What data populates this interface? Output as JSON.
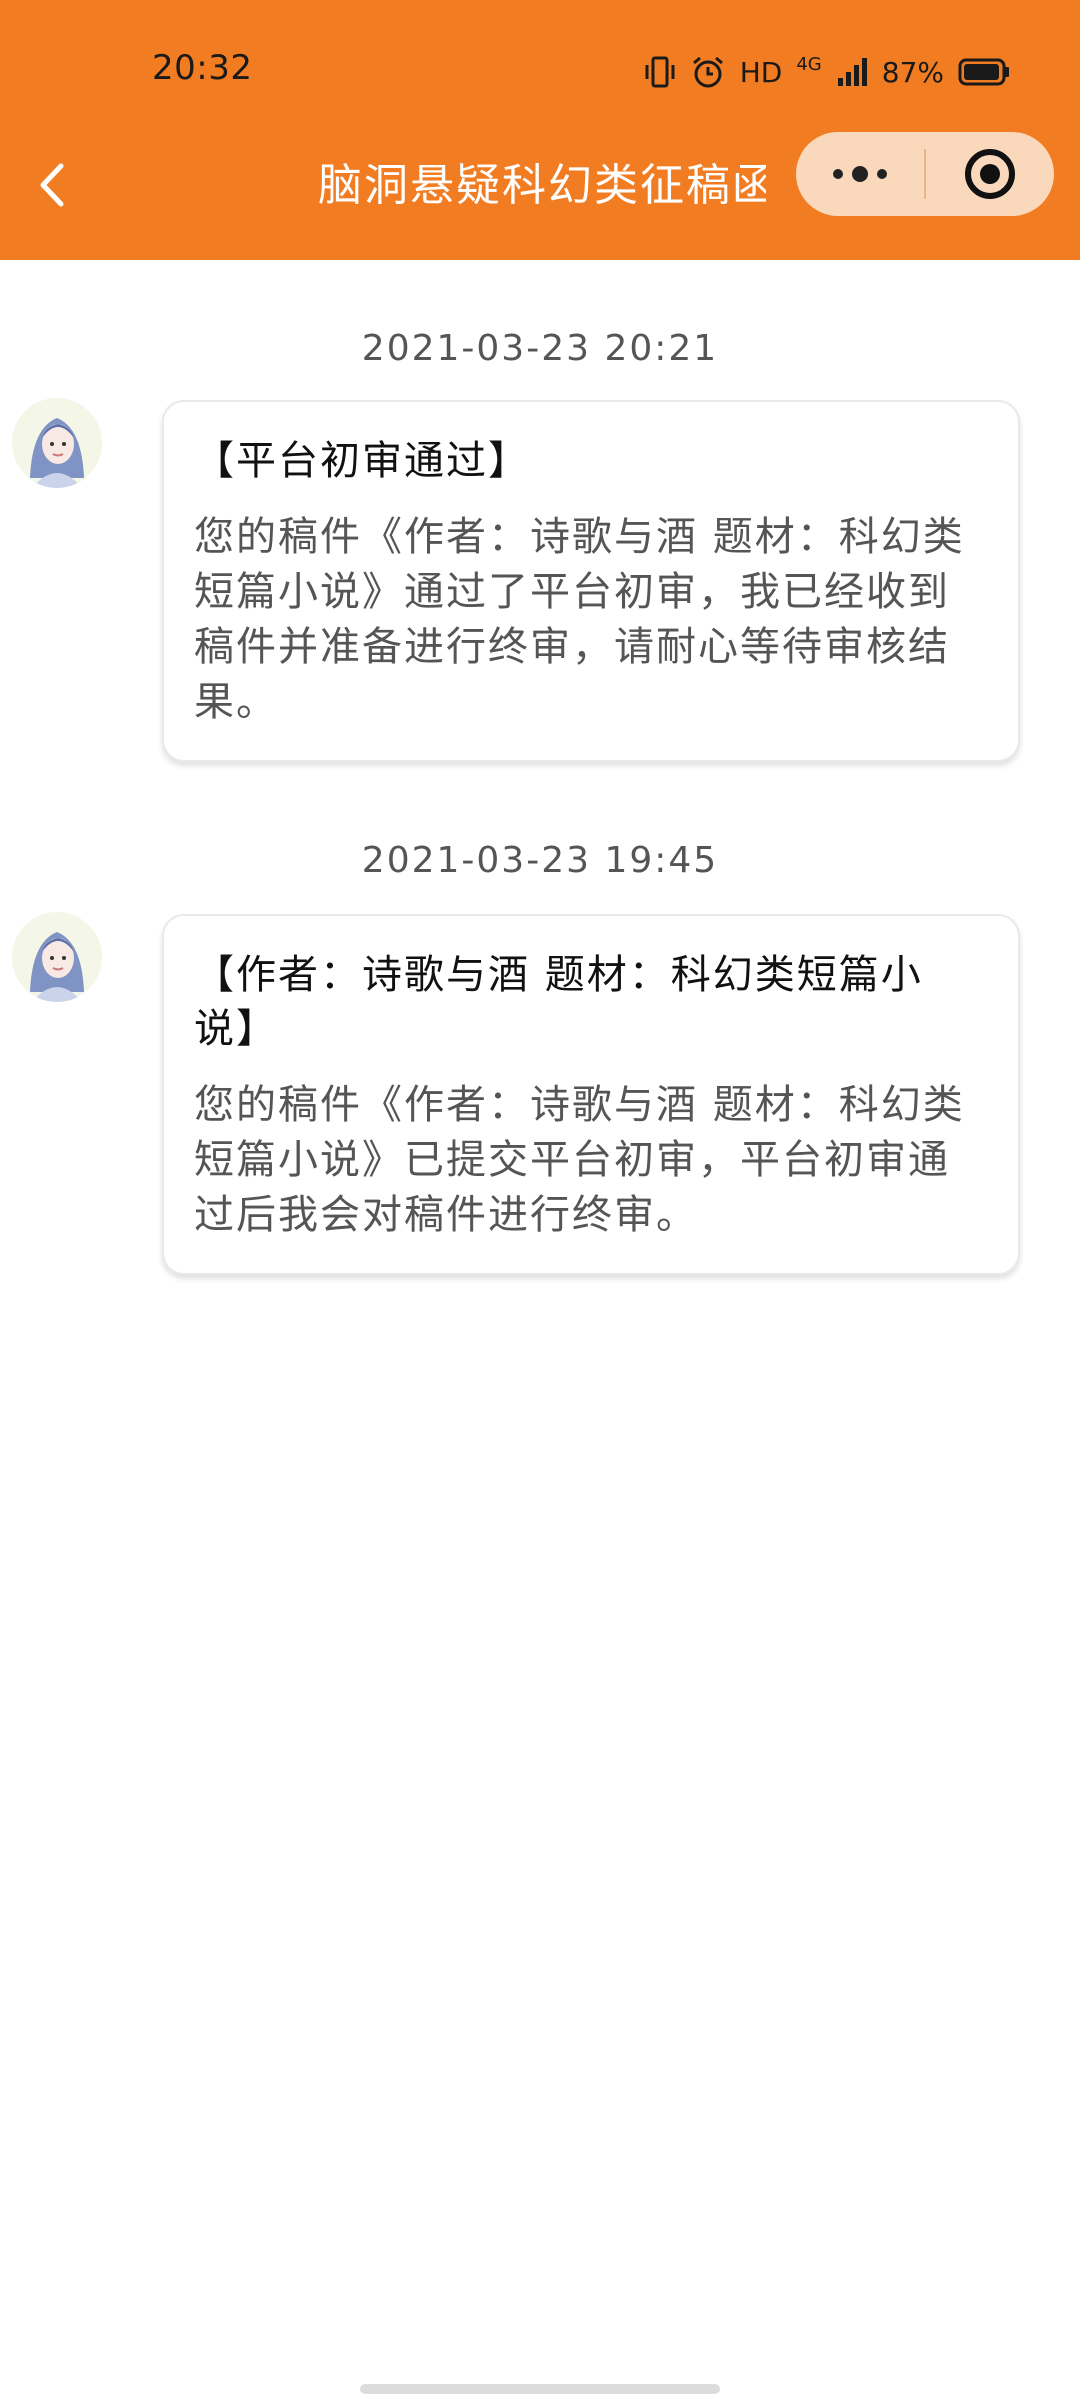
{
  "status_bar": {
    "time": "20:32",
    "network": "HD",
    "signal": "4G",
    "battery": "87%"
  },
  "nav": {
    "title": "脑洞悬疑科幻类征稿函",
    "back_icon": "chevron-left-icon",
    "more_icon": "more-dots-icon",
    "close_icon": "target-close-icon"
  },
  "messages": [
    {
      "timestamp": "2021-03-23 20:21",
      "title": "【平台初审通过】",
      "body": "您的稿件《作者：诗歌与酒 题材：科幻类短篇小说》通过了平台初审，我已经收到稿件并准备进行终审，请耐心等待审核结果。"
    },
    {
      "timestamp": "2021-03-23 19:45",
      "title": "【作者：诗歌与酒 题材：科幻类短篇小说】",
      "body": "您的稿件《作者：诗歌与酒 题材：科幻类短篇小说》已提交平台初审，平台初审通过后我会对稿件进行终审。"
    }
  ],
  "colors": {
    "header": "#f27c22",
    "capsule": "#f9d8bc",
    "timestamp": "#555555"
  }
}
